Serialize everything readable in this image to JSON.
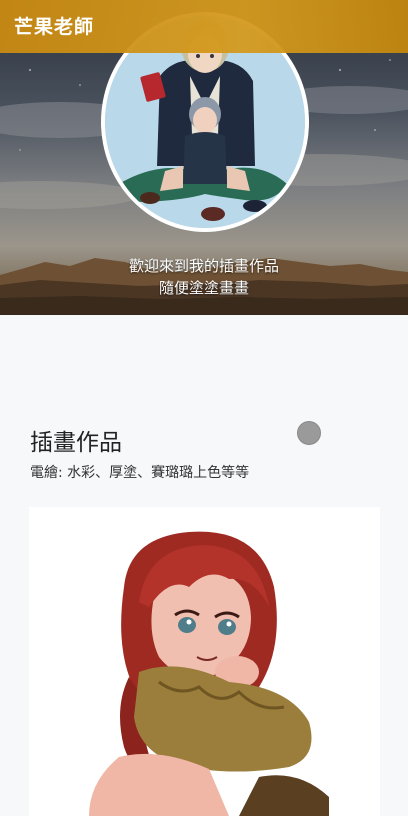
{
  "header": {
    "brand": "芒果老師"
  },
  "hero": {
    "welcome_line1": "歡迎來到我的插畫作品",
    "welcome_line2": "隨便塗塗畫畫",
    "avatar_icon": "avatar-illustration"
  },
  "section": {
    "title": "插畫作品",
    "subtitle": "電繪: 水彩、厚塗、賽璐璐上色等等"
  },
  "colors": {
    "header_bar": "#d49a1e",
    "page_bg": "#f7f8fa",
    "card_bg": "#ffffff",
    "scroll_indicator": "#9a9a9a"
  }
}
